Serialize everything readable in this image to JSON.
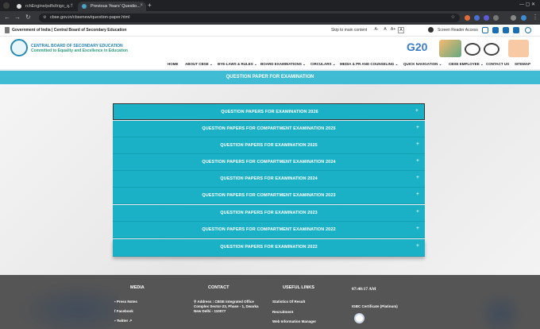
{
  "browser": {
    "tabs": [
      {
        "title": "rchEngine/pdfs/trigo_q..."
      },
      {
        "title": "Previous Years' Questio..."
      }
    ],
    "new_tab": "+",
    "url": "cbse.gov.in/cbsenew/question-paper.html"
  },
  "govbar": {
    "text": "Government of India | Central Board of Secondary Education",
    "skip": "Skip to main content",
    "font_sizes": [
      "A-",
      "A",
      "A+",
      "A"
    ],
    "screen_reader": "Screen Reader Access"
  },
  "header": {
    "org_name": "CENTRAL BOARD OF SECONDARY EDUCATION",
    "tagline": "Committed to Equality and Excellence in Education",
    "logo_g20": "G20"
  },
  "nav": {
    "items": [
      "HOME",
      "ABOUT CBSE ⌄",
      "BYE-LAWS & RULES ⌄",
      "BOARD EXAMINATIONS ⌄",
      "CIRCULARS ⌄",
      "MEDIA & PR AND COUNSELING ⌄",
      "QUICK NAVIGATION ⌄",
      "CBSE EMPLOYEE ⌄",
      "CONTACT US",
      "SITEMAP"
    ]
  },
  "banner": {
    "title": "QUESTION PAPER FOR EXAMINATION"
  },
  "accordion": [
    {
      "label": "QUESTION PAPERS FOR EXAMINATION 2026",
      "icon": "+"
    },
    {
      "label": "QUESTION PAPERS FOR COMPARTMENT EXAMINATION 2025",
      "icon": "+"
    },
    {
      "label": "QUESTION PAPERS FOR EXAMINATION 2025",
      "icon": "+"
    },
    {
      "label": "QUESTION PAPERS FOR COMPARTMENT EXAMINATION 2024",
      "icon": "+"
    },
    {
      "label": "QUESTION PAPERS FOR EXAMINATION 2024",
      "icon": "+"
    },
    {
      "label": "QUESTION PAPERS FOR COMPARTMENT EXAMINATION 2023",
      "icon": "+"
    },
    {
      "label": "QUESTION PAPERS FOR EXAMINATION 2023",
      "icon": "+"
    },
    {
      "label": "QUESTION PAPERS FOR COMPARTMENT EXAMINATION 2022",
      "icon": "+"
    },
    {
      "label": "QUESTION PAPERS FOR EXAMINATION 2022",
      "icon": "+"
    }
  ],
  "footer": {
    "media": {
      "heading": "MEDIA",
      "items": [
        "Press Notes",
        "Facebook",
        "Twitter"
      ]
    },
    "contact": {
      "heading": "CONTACT",
      "address_label": "Address :",
      "address": "CBSE Integrated Office Complex Sector-23, Phase - 1, Dwarka New Delhi - 110077"
    },
    "useful": {
      "heading": "USEFUL LINKS",
      "items": [
        "Statistics Of Result",
        "Recruitment",
        "Web Information Manager"
      ]
    },
    "clock": "07:40:17 AM",
    "certificate": "IGBC Certificate (Platinum)"
  },
  "colors": {
    "accent": "#1ab1c6",
    "banner": "#3fbcd3",
    "footer": "#555555"
  }
}
